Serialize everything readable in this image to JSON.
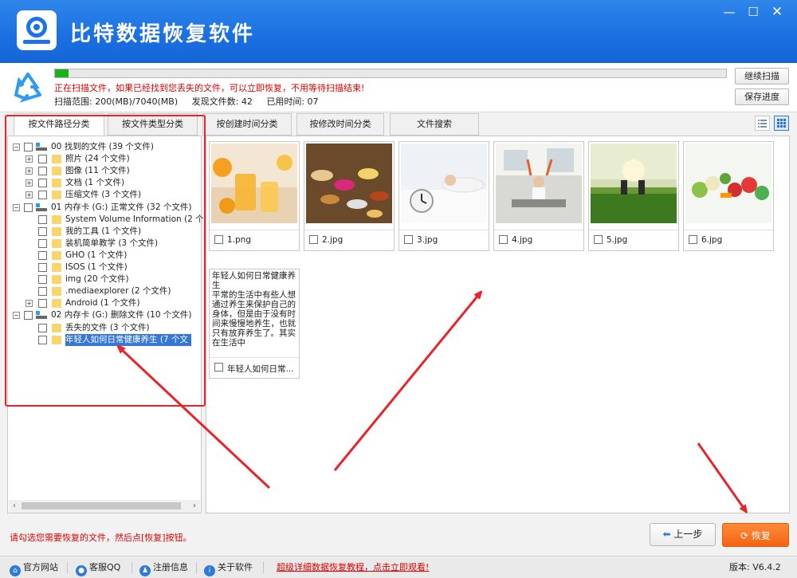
{
  "app": {
    "title": "比特数据恢复软件",
    "version": "版本: V6.4.2"
  },
  "window": {
    "minimize": "—",
    "maximize": "☐",
    "close": "✕"
  },
  "scan": {
    "progress_fraction": 0.02,
    "message": "正在扫描文件，如果已经找到您丢失的文件，可以立即恢复，不用等待扫描结束!",
    "range": "扫描范围: 200(MB)/7040(MB)",
    "found": "发现文件数: 42",
    "elapsed": "已用时间: 07",
    "continue_label": "继续扫描",
    "save_label": "保存进度"
  },
  "tabs": [
    "按文件路径分类",
    "按文件类型分类",
    "按创建时间分类",
    "按修改时间分类",
    "文件搜索"
  ],
  "view_icons": [
    "list-view-icon",
    "grid-view-icon"
  ],
  "tree": [
    {
      "level": 0,
      "expander": "⊟",
      "icon": "drive",
      "label": "00 找到的文件  (39 个文件)"
    },
    {
      "level": 1,
      "expander": "⊞",
      "icon": "folder",
      "label": "照片     (24 个文件)"
    },
    {
      "level": 1,
      "expander": "⊞",
      "icon": "folder",
      "label": "图像     (11 个文件)"
    },
    {
      "level": 1,
      "expander": "⊞",
      "icon": "folder",
      "label": "文档     (1 个文件)"
    },
    {
      "level": 1,
      "expander": "⊞",
      "icon": "folder",
      "label": "压缩文件    (3 个文件)"
    },
    {
      "level": 0,
      "expander": "⊟",
      "icon": "drive",
      "label": "01 内存卡 (G:) 正常文件 (32 个文件)"
    },
    {
      "level": 1,
      "expander": "",
      "icon": "folder",
      "label": "System Volume Information   (2 个文"
    },
    {
      "level": 1,
      "expander": "",
      "icon": "folder",
      "label": "我的工具    (1 个文件)"
    },
    {
      "level": 1,
      "expander": "",
      "icon": "folder",
      "label": "装机简单教学    (3 个文件)"
    },
    {
      "level": 1,
      "expander": "",
      "icon": "folder",
      "label": "GHO    (1 个文件)"
    },
    {
      "level": 1,
      "expander": "",
      "icon": "folder",
      "label": "ISOS    (1 个文件)"
    },
    {
      "level": 1,
      "expander": "",
      "icon": "folder",
      "label": "img    (20 个文件)"
    },
    {
      "level": 1,
      "expander": "",
      "icon": "folder",
      "label": ".mediaexplorer    (2 个文件)"
    },
    {
      "level": 1,
      "expander": "⊞",
      "icon": "folder",
      "label": "Android    (1 个文件)"
    },
    {
      "level": 0,
      "expander": "⊟",
      "icon": "drive",
      "label": "02 内存卡 (G:) 删除文件 (10 个文件)"
    },
    {
      "level": 1,
      "expander": "",
      "icon": "folder",
      "label": "丢失的文件      (3 个文件)"
    },
    {
      "level": 1,
      "expander": "",
      "icon": "folder",
      "label": "年轻人如何日常健康养生      (7 个文",
      "selected": true
    }
  ],
  "files": [
    {
      "name": "1.png",
      "scene": "juice"
    },
    {
      "name": "2.jpg",
      "scene": "pills"
    },
    {
      "name": "3.jpg",
      "scene": "sleep"
    },
    {
      "name": "4.jpg",
      "scene": "office"
    },
    {
      "name": "5.jpg",
      "scene": "run"
    },
    {
      "name": "6.jpg",
      "scene": "veggies"
    }
  ],
  "doc_file": {
    "name": "年轻人如何日常...",
    "preview": "年轻人如何日常健康养生\n平常的生活中有些人想通过养生来保护自己的身体，但是由于没有时间来慢慢地养生，也就只有放弃养生了。其实在生活中"
  },
  "bottom": {
    "hint": "请勾选您需要恢复的文件，然后点[恢复]按钮。",
    "prev_label": "上一步",
    "recover_label": "恢复"
  },
  "statusbar": {
    "website": "官方网站",
    "qq": "客服QQ",
    "register": "注册信息",
    "about": "关于软件",
    "tutorial_link": "超级详细数据恢复教程，点击立即观看!"
  },
  "colors": {
    "accent": "#1a6fe0",
    "warning": "#e00000",
    "recover": "#f46410",
    "progress": "#1cb01c",
    "annotation": "#e8242a"
  }
}
